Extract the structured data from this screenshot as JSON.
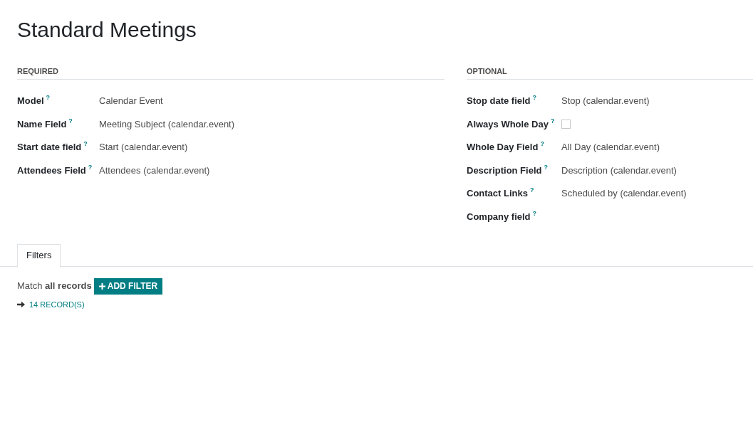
{
  "title": "Standard Meetings",
  "sections": [
    {
      "heading": "REQUIRED",
      "fields": [
        {
          "kind": "text",
          "label": "Model",
          "help": "?",
          "value": "Calendar Event"
        },
        {
          "kind": "text",
          "label": "Name Field",
          "help": "?",
          "value": "Meeting Subject (calendar.event)"
        },
        {
          "kind": "text",
          "label": "Start date field",
          "help": "?",
          "value": "Start (calendar.event)"
        },
        {
          "kind": "text",
          "label": "Attendees Field",
          "help": "?",
          "value": "Attendees (calendar.event)"
        }
      ]
    },
    {
      "heading": "OPTIONAL",
      "fields": [
        {
          "kind": "text",
          "label": "Stop date field",
          "help": "?",
          "value": "Stop (calendar.event)"
        },
        {
          "kind": "checkbox",
          "label": "Always Whole Day",
          "help": "?",
          "checked": false
        },
        {
          "kind": "text",
          "label": "Whole Day Field",
          "help": "?",
          "value": "All Day (calendar.event)"
        },
        {
          "kind": "text",
          "label": "Description Field",
          "help": "?",
          "value": "Description (calendar.event)"
        },
        {
          "kind": "text",
          "label": "Contact Links",
          "help": "?",
          "value": "Scheduled by (calendar.event)"
        },
        {
          "kind": "text",
          "label": "Company field",
          "help": "?"
        }
      ]
    }
  ],
  "tabs": [
    {
      "label": "Filters",
      "selected": true
    }
  ],
  "filter": {
    "match": "Match **all records**",
    "add_button": "ADD FILTER",
    "records_link": "14 RECORD(S)"
  }
}
